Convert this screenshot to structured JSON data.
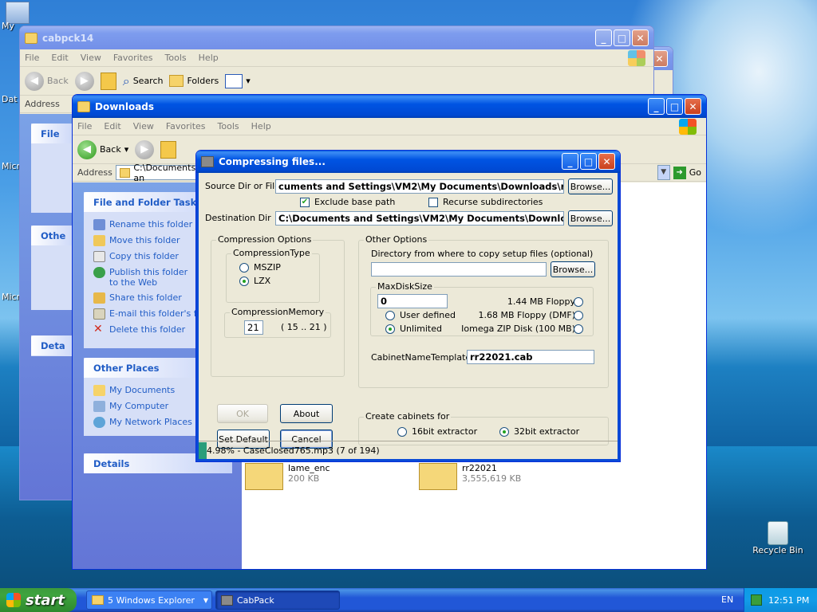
{
  "desktop": {
    "icons": [
      {
        "label": "My",
        "name": "my-documents-desktop-icon"
      },
      {
        "label": "Dat",
        "name": "data-desktop-icon"
      },
      {
        "label": "Micro",
        "name": "micro-desktop-icon-1"
      },
      {
        "label": "Micro",
        "name": "micro-desktop-icon-2"
      },
      {
        "label": "Recycle Bin",
        "name": "recycle-bin-icon"
      }
    ]
  },
  "back_window": {
    "title": "cabpck14",
    "menu": [
      "File",
      "Edit",
      "View",
      "Favorites",
      "Tools",
      "Help"
    ],
    "toolbar": {
      "back": "Back",
      "search": "Search",
      "folders": "Folders"
    },
    "address_label": "Address",
    "side_partial": [
      "File",
      "Othe",
      "Deta"
    ]
  },
  "downloads_window": {
    "title": "Downloads",
    "menu": [
      "File",
      "Edit",
      "View",
      "Favorites",
      "Tools",
      "Help"
    ],
    "toolbar": {
      "back": "Back"
    },
    "address_label": "Address",
    "address_value": "C:\\Documents an",
    "go_label": "Go",
    "file_tasks": {
      "header": "File and Folder Tasks",
      "items": [
        "Rename this folder",
        "Move this folder",
        "Copy this folder",
        "Publish this folder to the Web",
        "Share this folder",
        "E-mail this folder's files",
        "Delete this folder"
      ]
    },
    "other_places": {
      "header": "Other Places",
      "items": [
        "My Documents",
        "My Computer",
        "My Network Places"
      ]
    },
    "details": {
      "header": "Details"
    },
    "files": [
      {
        "name": "lame_enc",
        "size": "200 KB"
      },
      {
        "name": "rr22021",
        "size": "3,555,619 KB"
      }
    ]
  },
  "dialog": {
    "title": "Compressing files...",
    "source_label": "Source Dir or File",
    "source_value": "cuments and Settings\\VM2\\My Documents\\Downloads\\rr22021",
    "browse": "Browse...",
    "exclude_base_path": "Exclude base path",
    "recurse_subdirs": "Recurse subdirectories",
    "dest_label": "Destination Dir",
    "dest_value": "C:\\Documents and Settings\\VM2\\My Documents\\Downloads\\c",
    "compression_options": "Compression Options",
    "compression_type": "CompressionType",
    "mszip": "MSZIP",
    "lzx": "LZX",
    "compression_memory": "CompressionMemory",
    "memory_value": "21",
    "memory_range": "( 15 .. 21 )",
    "other_options": "Other Options",
    "setup_dir_label": "Directory from where to copy setup files (optional)",
    "setup_dir_value": "",
    "max_disk_size": "MaxDiskSize",
    "max_disk_value": "0",
    "user_defined": "User defined",
    "unlimited": "Unlimited",
    "floppy_144": "1.44 MB Floppy",
    "floppy_168": "1.68 MB Floppy (DMF)",
    "zip_disk": "Iomega ZIP Disk (100 MB)",
    "cab_name_label": "CabinetNameTemplate",
    "cab_name_value": "rr22021.cab",
    "ok": "OK",
    "about": "About",
    "set_default": "Set Default",
    "cancel": "Cancel",
    "create_cabinets_for": "Create cabinets for",
    "bit16": "16bit extractor",
    "bit32": "32bit extractor",
    "status": "4.98% - CaseClosed765.mp3 (7 of 194)",
    "progress_percent": 4.98
  },
  "taskbar": {
    "start": "start",
    "task1": "5 Windows Explorer",
    "task2": "CabPack",
    "lang": "EN",
    "time": "12:51 PM"
  }
}
